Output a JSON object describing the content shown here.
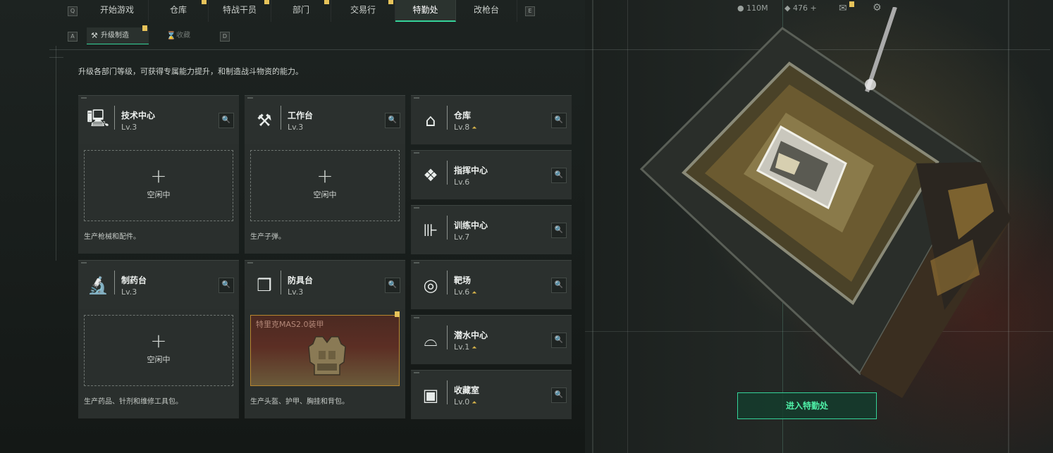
{
  "top_nav": {
    "key_left": "Q",
    "key_right": "E",
    "tabs": [
      {
        "label": "开始游戏",
        "badge": false
      },
      {
        "label": "仓库",
        "badge": true
      },
      {
        "label": "特战干员",
        "badge": true
      },
      {
        "label": "部门",
        "badge": true
      },
      {
        "label": "交易行",
        "badge": true
      },
      {
        "label": "特勤处",
        "badge": false,
        "active": true
      },
      {
        "label": "改枪台",
        "badge": false
      }
    ]
  },
  "resources": {
    "currency": "110M",
    "coins": "476",
    "add": "+"
  },
  "sub_tabs": {
    "key_left": "A",
    "key_right": "D",
    "upgrade": "升级制造",
    "collection": "收藏"
  },
  "description": "升级各部门等级，可获得专属能力提升，和制造战斗物资的能力。",
  "workshops": [
    {
      "name": "技术中心",
      "level": "Lv.3",
      "icon": "computer-icon",
      "status": "空闲中",
      "caption": "生产枪械和配件。"
    },
    {
      "name": "工作台",
      "level": "Lv.3",
      "icon": "tools-icon",
      "status": "空闲中",
      "caption": "生产子弹。"
    },
    {
      "name": "制药台",
      "level": "Lv.3",
      "icon": "microscope-icon",
      "status": "空闲中",
      "caption": "生产药品、针剂和维修工具包。"
    },
    {
      "name": "防具台",
      "level": "Lv.3",
      "icon": "cubes-icon",
      "product": "特里克MAS2.0装甲",
      "caption": "生产头盔、护甲、胸挂和背包。"
    }
  ],
  "departments": [
    {
      "name": "仓库",
      "level": "Lv.8",
      "icon": "warehouse-icon",
      "upgradable": true
    },
    {
      "name": "指挥中心",
      "level": "Lv.6",
      "icon": "command-icon",
      "upgradable": false
    },
    {
      "name": "训练中心",
      "level": "Lv.7",
      "icon": "dumbbell-icon",
      "upgradable": false
    },
    {
      "name": "靶场",
      "level": "Lv.6",
      "icon": "target-icon",
      "upgradable": true
    },
    {
      "name": "潜水中心",
      "level": "Lv.1",
      "icon": "diving-mask-icon",
      "upgradable": true
    },
    {
      "name": "收藏室",
      "level": "Lv.0",
      "icon": "trophy-case-icon",
      "upgradable": true
    }
  ],
  "enter_button": "进入特勤处",
  "search_glyph": "🔍",
  "plus_glyph": "+",
  "colors": {
    "accent": "#35d39a",
    "badge": "#e7c35a",
    "product_border": "#b8862f"
  }
}
